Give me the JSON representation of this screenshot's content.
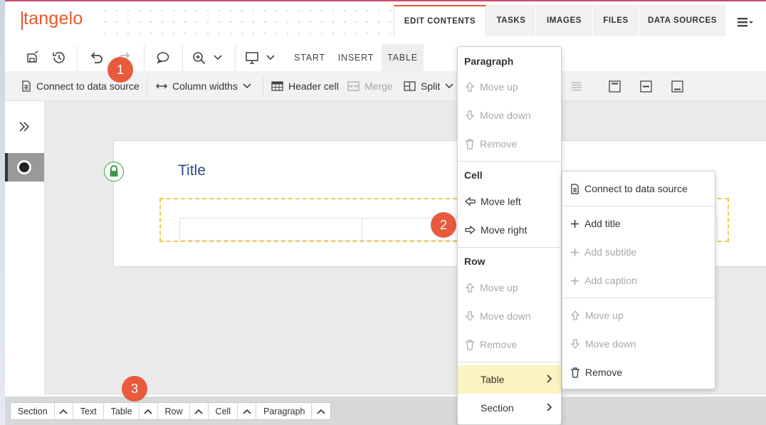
{
  "app": {
    "logo": "tangelo"
  },
  "tabs": [
    {
      "label": "EDIT CONTENTS",
      "active": true
    },
    {
      "label": "TASKS"
    },
    {
      "label": "IMAGES"
    },
    {
      "label": "FILES"
    },
    {
      "label": "DATA SOURCES"
    }
  ],
  "toolbar": {
    "modes": [
      {
        "label": "START"
      },
      {
        "label": "INSERT"
      },
      {
        "label": "TABLE",
        "active": true
      }
    ]
  },
  "table_toolbar": {
    "connect": "Connect to data source",
    "column_widths": "Column widths",
    "header_cell": "Header cell",
    "merge": "Merge",
    "split": "Split"
  },
  "document": {
    "title": "Title"
  },
  "badges": [
    "1",
    "2",
    "3"
  ],
  "breadcrumb": [
    "Section",
    "Text",
    "Table",
    "Row",
    "Cell",
    "Paragraph"
  ],
  "context_menu": {
    "paragraph": {
      "header": "Paragraph",
      "items": [
        "Move up",
        "Move down",
        "Remove"
      ]
    },
    "cell": {
      "header": "Cell",
      "items": [
        "Move left",
        "Move right"
      ]
    },
    "row": {
      "header": "Row",
      "items": [
        "Move up",
        "Move down",
        "Remove"
      ]
    },
    "submenus": [
      "Table",
      "Section"
    ]
  },
  "table_submenu": {
    "items": [
      "Connect to data source",
      "Add title",
      "Add subtitle",
      "Add caption",
      "Move up",
      "Move down",
      "Remove"
    ]
  },
  "colors": {
    "accent": "#e8562a",
    "badge": "#e85a3c",
    "title": "#2c4a8a",
    "highlight": "#fdf3c0",
    "selection_border": "#f2c94c"
  }
}
